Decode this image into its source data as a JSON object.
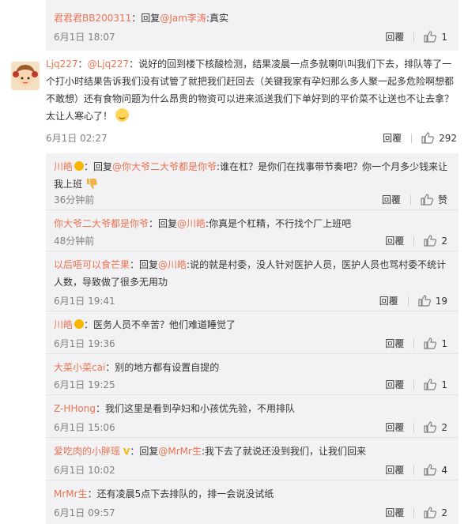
{
  "reply_label": "回覆",
  "colors": {
    "accent": "#eb7350",
    "meta": "#808080",
    "reply_bg": "#f2f2f5"
  },
  "top_reply": {
    "user": "君君君BB200311",
    "sep": "：",
    "reply_prefix": "回复",
    "mention": "@Jam李涛",
    "mention_suffix": ":真实",
    "date": "6月1日 18:07",
    "likes": "1"
  },
  "comment": {
    "user": "Ljq227",
    "sep": "：",
    "mention": "@Ljq227",
    "text": "：说好的回到楼下核酸检测，结果凌晨一点多就喇叭叫我们下去，排队等了一个打小时结果告诉我们没有试管了就把我们赶回去（关键我家有孕妇那么多人聚一起多危险啊想都不敢想）还有食物问题为什么昂贵的物资可以进来派送我们下单好到的平价菜不让送也不让去拿？太让人寒心了！",
    "date": "6月1日 02:27",
    "likes": "292"
  },
  "replies": [
    {
      "user": "川皓",
      "text_before": "：回复",
      "mention": "@你大爷二大爷都是你爷",
      "text": ":谁在杠？是你们在找事带节奏吧？你一个月多少钱来让我上班",
      "date": "36分钟前",
      "likes": "赞"
    },
    {
      "user": "你大爷二大爷都是你爷",
      "text_before": "：回复",
      "mention": "@川皓",
      "text": ":你真是个杠精，不行找个厂上班吧",
      "date": "48分钟前",
      "likes": "2"
    },
    {
      "user": "以后唔可以食芒果",
      "text_before": "：回复",
      "mention": "@川皓",
      "text": ":说的就是村委，没人针对医护人员，医护人员也骂村委不统计人数，导致做了很多无用功",
      "date": "6月1日 19:41",
      "likes": "19"
    },
    {
      "user": "川皓",
      "text_before": "：医务人员不辛苦？他们难道睡觉了",
      "mention": "",
      "text": "",
      "date": "6月1日 19:36",
      "likes": "1"
    },
    {
      "user": "大菜小菜cai",
      "text_before": "：别的地方都有设置自提的",
      "mention": "",
      "text": "",
      "date": "6月1日 19:25",
      "likes": "1"
    },
    {
      "user": "Z-HHong",
      "text_before": "：我们这里是看到孕妇和小孩优先验，不用排队",
      "mention": "",
      "text": "",
      "date": "6月1日 15:06",
      "likes": "2"
    },
    {
      "user": "爱吃肉的小胖瑶",
      "text_before": "：回复",
      "mention": "@MrMr生",
      "text": ":我下去了就说还没到我们，让我们回来",
      "date": "6月1日 10:02",
      "likes": "4"
    },
    {
      "user": "MrMr生",
      "text_before": "：还有凌晨5点下去排队的，排一会说没试纸",
      "mention": "",
      "text": "",
      "date": "6月1日 09:57",
      "likes": "2"
    }
  ]
}
